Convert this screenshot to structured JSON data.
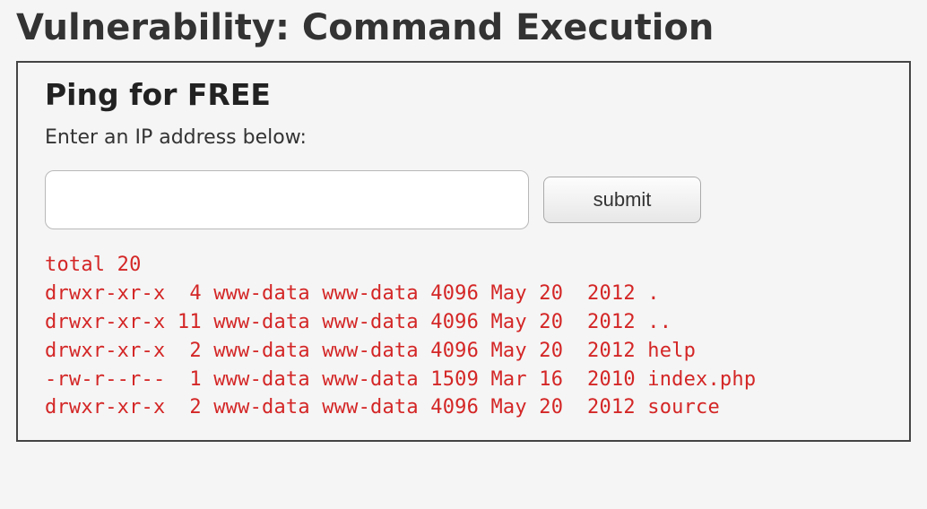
{
  "page": {
    "title": "Vulnerability: Command Execution"
  },
  "form": {
    "section_title": "Ping for FREE",
    "instructions": "Enter an IP address below:",
    "ip_value": "",
    "ip_placeholder": "",
    "submit_label": "submit"
  },
  "output": {
    "text": "total 20\ndrwxr-xr-x  4 www-data www-data 4096 May 20  2012 .\ndrwxr-xr-x 11 www-data www-data 4096 May 20  2012 ..\ndrwxr-xr-x  2 www-data www-data 4096 May 20  2012 help\n-rw-r--r--  1 www-data www-data 1509 Mar 16  2010 index.php\ndrwxr-xr-x  2 www-data www-data 4096 May 20  2012 source"
  }
}
